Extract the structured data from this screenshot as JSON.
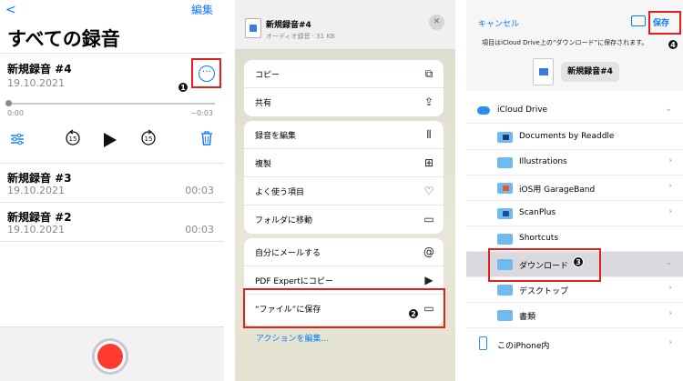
{
  "panel1": {
    "back_glyph": "<",
    "edit_label": "編集",
    "title": "すべての録音",
    "recordings": [
      {
        "name": "新規録音 #4",
        "date": "19.10.2021",
        "duration": ""
      },
      {
        "name": "新規録音 #3",
        "date": "19.10.2021",
        "duration": "00:03"
      },
      {
        "name": "新規録音 #2",
        "date": "19.10.2021",
        "duration": "00:03"
      }
    ],
    "time_start": "0:00",
    "time_end": "−0:03",
    "step_badge": "1"
  },
  "panel2": {
    "file_name": "新規録音#4",
    "file_sub": "オーディオ録音 · 31 KB",
    "close_glyph": "✕",
    "groups": [
      [
        {
          "label": "コピー",
          "icon": "copy-icon"
        },
        {
          "label": "共有",
          "icon": "share-icon"
        }
      ],
      [
        {
          "label": "録音を編集",
          "icon": "waveform-icon"
        },
        {
          "label": "複製",
          "icon": "duplicate-icon"
        },
        {
          "label": "よく使う項目",
          "icon": "heart-icon"
        },
        {
          "label": "フォルダに移動",
          "icon": "folder-icon"
        }
      ],
      [
        {
          "label": "自分にメールする",
          "icon": "at-icon"
        },
        {
          "label": "PDF Expertにコピー",
          "icon": "pdf-expert-icon"
        },
        {
          "label": "“ファイル”に保存",
          "icon": "folder-icon"
        }
      ]
    ],
    "edit_actions": "アクションを編集...",
    "step_badge": "2"
  },
  "panel3": {
    "cancel": "キャンセル",
    "save": "保存",
    "note": "項目はiCloud Drive上の“ダウンロード”に保存されます。",
    "file_name": "新規録音#4",
    "icloud_label": "iCloud Drive",
    "folders": [
      "Documents by Readdle",
      "Illustrations",
      "iOS用 GarageBand",
      "ScanPlus",
      "Shortcuts",
      "ダウンロード",
      "デスクトップ",
      "書類"
    ],
    "iphone_label": "このiPhone内",
    "step_badge_save": "4",
    "step_badge_folder": "3"
  },
  "colors": {
    "accent": "#0a7aff",
    "highlight": "#e0201b",
    "record": "#ff3b30"
  }
}
